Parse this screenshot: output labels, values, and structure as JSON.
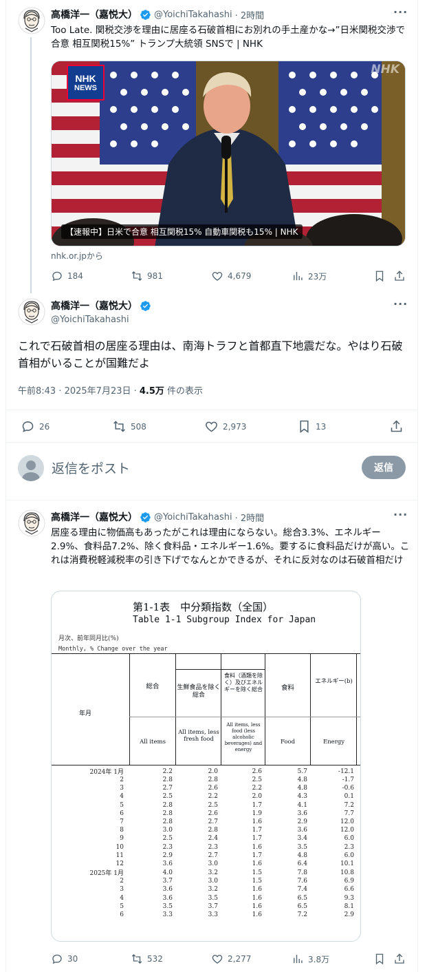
{
  "tweet1": {
    "name": "高橋洋一（嘉悦大）",
    "handle": "@YoichiTakahashi",
    "time": "· 2時間",
    "more": "···",
    "text": "Too Late. 関税交渉を理由に居座る石破首相にお別れの手土産かな→”日米関税交渉で合意 相互関税15%” トランプ大統領 SNSで | NHK",
    "card": {
      "logo_top": "NHK",
      "logo_bottom": "NEWS",
      "watermark": "NHK",
      "caption": "【速報中】日米で合意 相互関税15% 自動車関税も15% | NHK",
      "source": "nhk.or.jpから"
    },
    "stats": {
      "replies": "184",
      "reposts": "981",
      "likes": "4,679",
      "views": "23万"
    }
  },
  "tweet2": {
    "name": "高橋洋一（嘉悦大）",
    "handle": "@YoichiTakahashi",
    "more": "···",
    "text": "これで石破首相の居座る理由は、南海トラフと首都直下地震だな。やはり石破首相がいることが国難だよ",
    "meta_time": "午前8:43 · 2025年7月23日 · ",
    "meta_views": "4.5万",
    "meta_views_suffix": " 件の表示",
    "stats": {
      "replies": "26",
      "reposts": "508",
      "likes": "2,973",
      "bookmarks": "13"
    }
  },
  "reply_box": {
    "placeholder": "返信をポスト",
    "button": "返信"
  },
  "tweet3": {
    "name": "高橋洋一（嘉悦大）",
    "handle": "@YoichiTakahashi",
    "time": "· 2時間",
    "more": "···",
    "text": "居座る理由に物価高もあったがこれは理由にならない。総合3.3%、エネルギー2.9%、食料品7.2%、除く食料品・エネルギー1.6%。要するに食料品だけが高い。これは消費税軽減税率の引き下げでなんとかできるが、それに反対なのは石破首相だけ",
    "table": {
      "title_jp": "第1-1表　中分類指数（全国）",
      "title_en": "Table 1-1 Subgroup Index for Japan",
      "note_jp": "月次、前年同月比(%)",
      "note_en": "Monthly, % Change over the year",
      "year_month": "年月",
      "col_headers_jp": [
        "総合",
        "生鮮食品を除く総合",
        "食料（酒類を除く）及びエネルギーを除く総合",
        "食料",
        "エネルギー(b)"
      ],
      "col_headers_en": [
        "All items",
        "All items, less fresh food",
        "All items, less food (less alcoholic beverages) and energy",
        "Food",
        "Energy"
      ],
      "rows": [
        [
          "2024年 1月",
          "2.2",
          "2.0",
          "2.6",
          "5.7",
          "-12.1"
        ],
        [
          "2",
          "2.8",
          "2.8",
          "2.5",
          "4.8",
          "-1.7"
        ],
        [
          "3",
          "2.7",
          "2.6",
          "2.2",
          "4.8",
          "-0.6"
        ],
        [
          "4",
          "2.5",
          "2.2",
          "2.0",
          "4.3",
          "0.1"
        ],
        [
          "5",
          "2.8",
          "2.5",
          "1.7",
          "4.1",
          "7.2"
        ],
        [
          "6",
          "2.8",
          "2.6",
          "1.9",
          "3.6",
          "7.7"
        ],
        [
          "7",
          "2.8",
          "2.7",
          "1.6",
          "2.9",
          "12.0"
        ],
        [
          "8",
          "3.0",
          "2.8",
          "1.7",
          "3.6",
          "12.0"
        ],
        [
          "9",
          "2.5",
          "2.4",
          "1.7",
          "3.4",
          "6.0"
        ],
        [
          "10",
          "2.3",
          "2.3",
          "1.6",
          "3.5",
          "2.3"
        ],
        [
          "11",
          "2.9",
          "2.7",
          "1.7",
          "4.8",
          "6.0"
        ],
        [
          "12",
          "3.6",
          "3.0",
          "1.6",
          "6.4",
          "10.1"
        ],
        [
          "2025年 1月",
          "4.0",
          "3.2",
          "1.5",
          "7.8",
          "10.8"
        ],
        [
          "2",
          "3.7",
          "3.0",
          "1.5",
          "7.6",
          "6.9"
        ],
        [
          "3",
          "3.6",
          "3.2",
          "1.6",
          "7.4",
          "6.6"
        ],
        [
          "4",
          "3.6",
          "3.5",
          "1.6",
          "6.5",
          "9.3"
        ],
        [
          "5",
          "3.5",
          "3.7",
          "1.6",
          "6.5",
          "8.1"
        ],
        [
          "6",
          "3.3",
          "3.3",
          "1.6",
          "7.2",
          "2.9"
        ]
      ]
    },
    "stats": {
      "replies": "30",
      "reposts": "532",
      "likes": "2,277",
      "views": "3.8万"
    }
  },
  "colors": {
    "verified": "#1d9bf0",
    "text_secondary": "#536471",
    "reply_button": "#8b98a5"
  }
}
